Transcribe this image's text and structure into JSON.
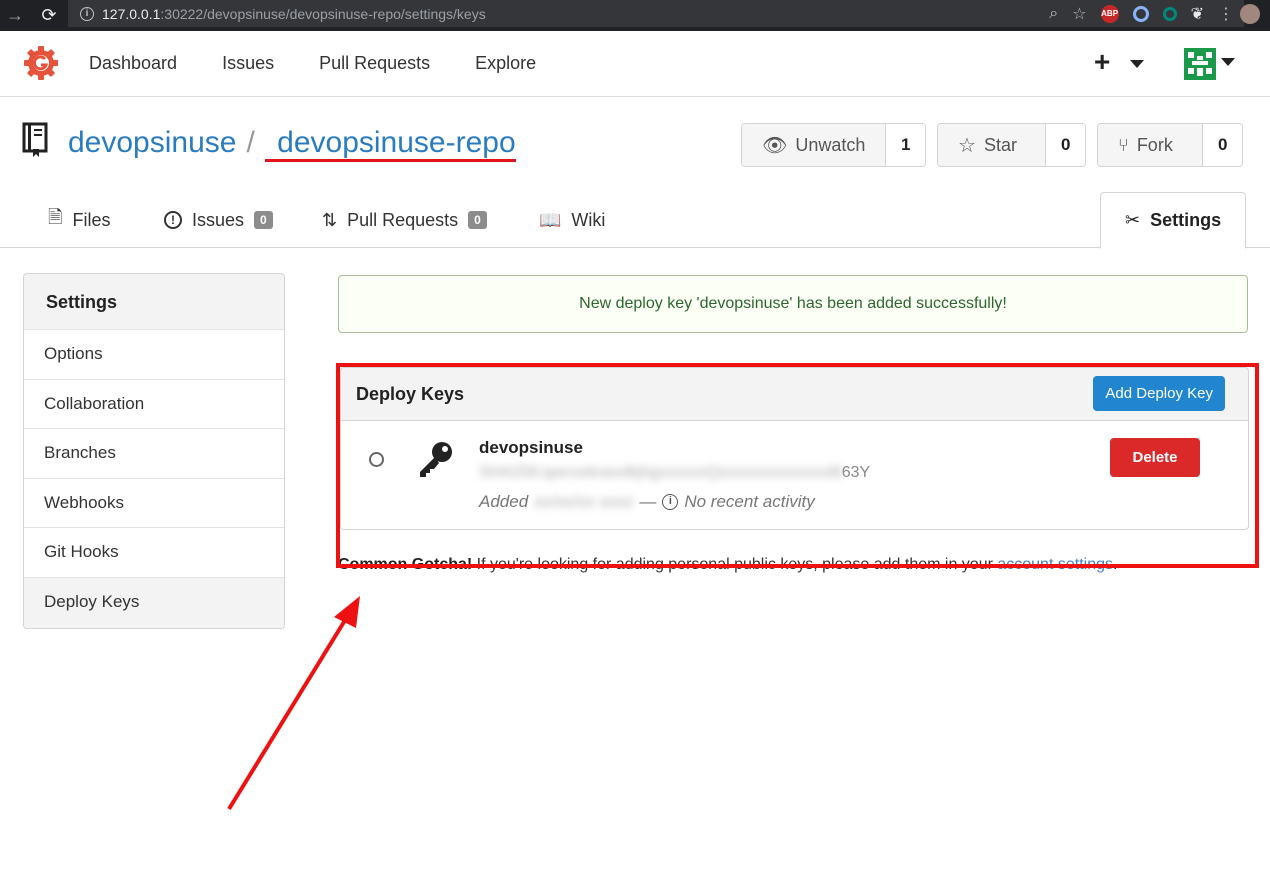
{
  "browser": {
    "url_host": "127.0.0.1",
    "url_rest": ":30222/devopsinuse/devopsinuse-repo/settings/keys",
    "extensions": [
      "zoom-icon",
      "star-icon",
      "adblock-icon",
      "extension-icon",
      "extension-teal-icon",
      "gnome-icon"
    ],
    "abp_label": "ABP"
  },
  "nav": {
    "items": [
      "Dashboard",
      "Issues",
      "Pull Requests",
      "Explore"
    ],
    "plus_label": "+"
  },
  "repo": {
    "owner": "devopsinuse",
    "separator": "/",
    "name": " devopsinuse-repo",
    "watch": {
      "label": "Unwatch",
      "count": "1"
    },
    "star": {
      "label": "Star",
      "count": "0"
    },
    "fork": {
      "label": "Fork",
      "count": "0"
    }
  },
  "tabs": {
    "files": "Files",
    "issues": {
      "label": "Issues",
      "badge": "0"
    },
    "pulls": {
      "label": "Pull Requests",
      "badge": "0"
    },
    "wiki": "Wiki",
    "settings": "Settings"
  },
  "sidebar": {
    "title": "Settings",
    "items": [
      "Options",
      "Collaboration",
      "Branches",
      "Webhooks",
      "Git Hooks",
      "Deploy Keys"
    ],
    "active": "Deploy Keys"
  },
  "flash": {
    "message": "New deploy key 'devopsinuse' has been added successfully!",
    "color": "#2c662d"
  },
  "deploy_keys": {
    "title": "Deploy Keys",
    "add_button": "Add Deploy Key",
    "key": {
      "name": "devopsinuse",
      "fingerprint_blurred": "SHA256:qwcxxkraxxlkjhgxxxxxxQxxxxxxxxxxxxxxB",
      "fingerprint_visible": "63Y",
      "added_label": "Added",
      "added_date_blurred": "xx/xx/xx xxxx",
      "dash": "—",
      "activity": "No recent activity",
      "delete_button": "Delete"
    }
  },
  "gotcha": {
    "bold": "Common Gotcha!",
    "text": " If you're looking for adding personal public keys, please add them in your ",
    "link": "account settings",
    "end": "."
  },
  "colors": {
    "accent": "#2185d0",
    "danger": "#db2828",
    "link": "#2a7cc1",
    "annotation": "#ee1111"
  }
}
